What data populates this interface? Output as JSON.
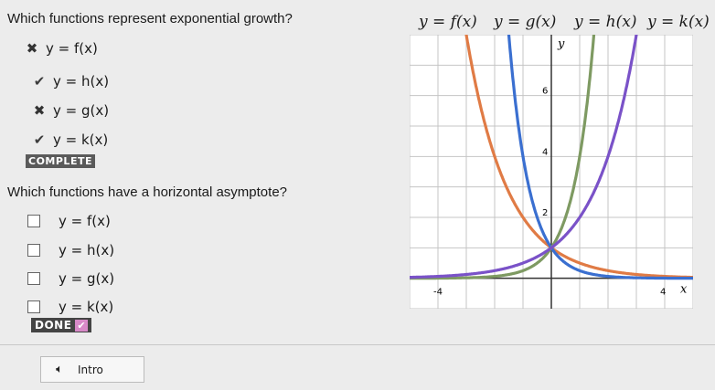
{
  "question1": {
    "text": "Which functions represent exponential growth?",
    "options": [
      {
        "label": "y = f(x)",
        "mark": "✖",
        "state": "incorrect"
      },
      {
        "label": "y = h(x)",
        "mark": "✔",
        "state": "correct"
      },
      {
        "label": "y = g(x)",
        "mark": "✖",
        "state": "incorrect"
      },
      {
        "label": "y = k(x)",
        "mark": "✔",
        "state": "correct"
      }
    ],
    "status": "COMPLETE"
  },
  "question2": {
    "text": "Which functions have a horizontal asymptote?",
    "options": [
      {
        "label": "y = f(x)"
      },
      {
        "label": "y = h(x)"
      },
      {
        "label": "y = g(x)"
      },
      {
        "label": "y = k(x)"
      }
    ],
    "done_label": "DONE",
    "done_check": "✔"
  },
  "legend": [
    "y = f(x)",
    "y = g(x)",
    "y = h(x)",
    "y = k(x)"
  ],
  "chart_data": {
    "type": "line",
    "axis_labels": {
      "x": "x",
      "y": "y"
    },
    "x_tick_labels": [
      "-4",
      "4"
    ],
    "y_tick_labels": [
      "2",
      "4",
      "6"
    ],
    "xlim": [
      -5,
      5
    ],
    "ylim": [
      -1,
      8
    ],
    "grid": true,
    "series": [
      {
        "name": "y = f(x)",
        "color": "#e07b45",
        "fn": "0.5^x",
        "x": [
          -4,
          -3,
          -2,
          -1,
          0,
          1,
          2,
          3,
          4
        ],
        "y": [
          16,
          8,
          4,
          2,
          1,
          0.5,
          0.25,
          0.125,
          0.0625
        ]
      },
      {
        "name": "y = g(x)",
        "color": "#3a6fd0",
        "fn": "0.25^x",
        "x": [
          -2,
          -1,
          0,
          1,
          2,
          3,
          4
        ],
        "y": [
          16,
          4,
          1,
          0.25,
          0.0625,
          0.016,
          0.004
        ]
      },
      {
        "name": "y = h(x)",
        "color": "#7e9a62",
        "fn": "4^x",
        "x": [
          -4,
          -3,
          -2,
          -1,
          0,
          1,
          2
        ],
        "y": [
          0.004,
          0.016,
          0.0625,
          0.25,
          1,
          4,
          16
        ]
      },
      {
        "name": "y = k(x)",
        "color": "#7a52c8",
        "fn": "2^x",
        "x": [
          -4,
          -3,
          -2,
          -1,
          0,
          1,
          2,
          3,
          4
        ],
        "y": [
          0.0625,
          0.125,
          0.25,
          0.5,
          1,
          2,
          4,
          8,
          16
        ]
      }
    ]
  },
  "audio_button": {
    "label": "Intro",
    "icon": "speaker-icon"
  }
}
